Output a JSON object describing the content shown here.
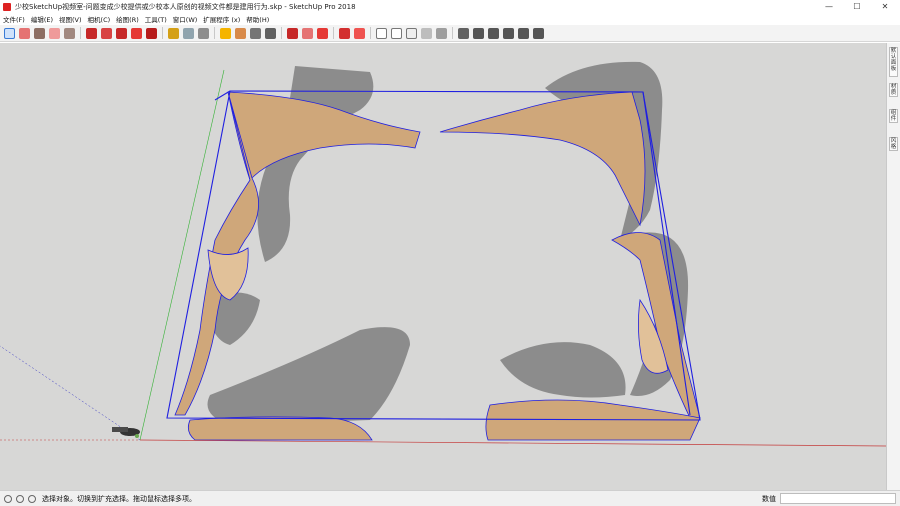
{
  "window": {
    "title": "少校SketchUp视频室-问题变成少校提供或少校本人原创的视频文件都是建用行为.skp - SketchUp Pro 2018",
    "minimize": "—",
    "maximize": "☐",
    "close": "✕"
  },
  "menu": [
    "文件(F)",
    "编辑(E)",
    "视图(V)",
    "相机(C)",
    "绘图(R)",
    "工具(T)",
    "窗口(W)",
    "扩展程序 (x)",
    "帮助(H)"
  ],
  "toolbar": {
    "icons": [
      "select-icon",
      "eraser-icon",
      "pencil-icon",
      "arc-icon",
      "rectangle-icon",
      "push-pull-icon",
      "offset-icon",
      "move-icon",
      "rotate-icon",
      "scale-icon",
      "tape-icon",
      "text-icon",
      "paint-icon",
      "orbit-icon",
      "pan-icon",
      "zoom-icon",
      "zoom-extents-icon",
      "warehouse-icon",
      "component-icon",
      "extension-icon",
      "section-icon",
      "layers-icon",
      "xray-icon",
      "wireframe-icon",
      "hidden-line-icon",
      "shaded-icon",
      "textured-icon",
      "monochrome-icon",
      "iso-view-icon",
      "top-view-icon",
      "front-view-icon",
      "right-view-icon",
      "back-view-icon",
      "left-view-icon"
    ],
    "colors": {
      "accent": "#3a7bd5",
      "red": "#c62828"
    }
  },
  "tray": {
    "tabs": [
      "默认面板",
      "材质",
      "组件",
      "风格"
    ]
  },
  "model": {
    "bounding_box_color": "#1f1fe0",
    "wood_color": "#cfa77a",
    "shadow_color": "#8a8a8a",
    "ground_color": "#d7d7d6"
  },
  "status": {
    "message": "选择对象。切换到扩充选择。拖动鼠标选择多项。",
    "measure_label": "数值",
    "measure_value": ""
  }
}
